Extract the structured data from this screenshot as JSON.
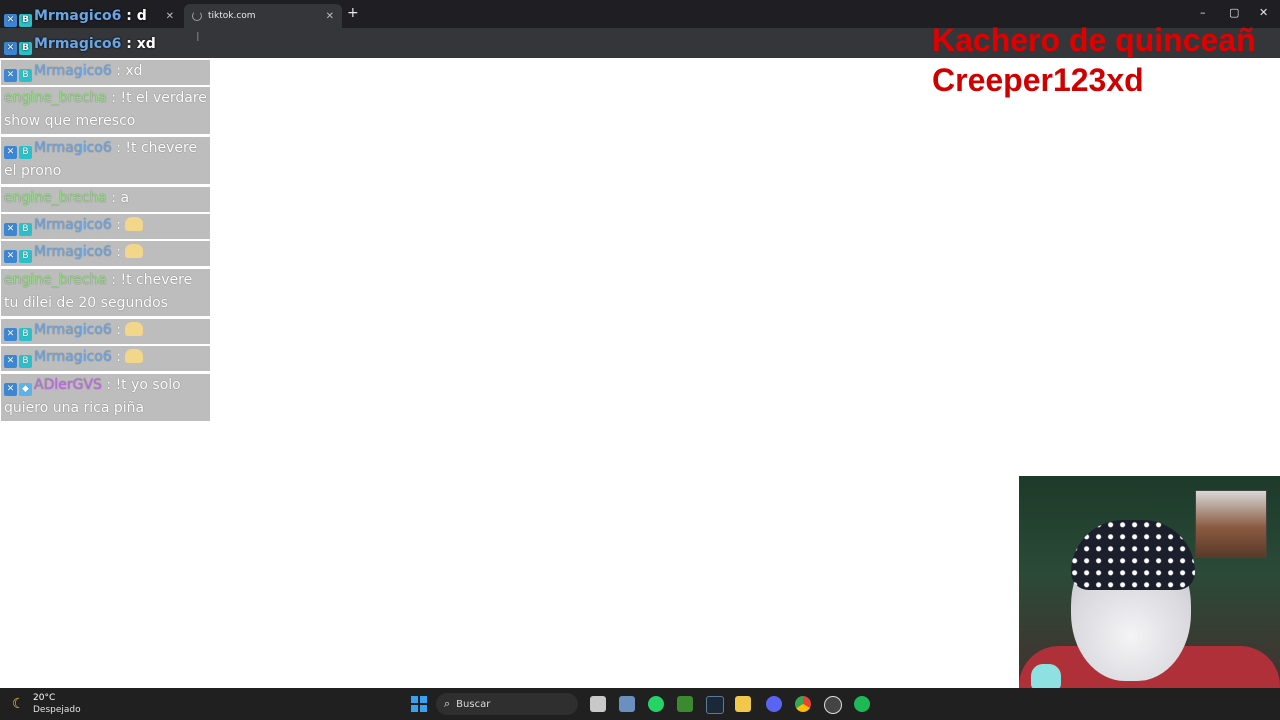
{
  "browser": {
    "tabs": [
      {
        "label": ""
      },
      {
        "label": "tiktok.com"
      }
    ],
    "new_tab_symbol": "+",
    "window_controls": {
      "minimize": "–",
      "maximize": "▢",
      "close": "✕"
    }
  },
  "chat": {
    "messages": [
      {
        "user": "Mrmagico6",
        "text": "d",
        "color": "blue"
      },
      {
        "user": "Mrmagico6",
        "text": "xd",
        "color": "blue"
      },
      {
        "user": "Mrmagico6",
        "text": "xd",
        "color": "blue"
      },
      {
        "user": "engine_brecha",
        "text": "!t el verdare show que meresco",
        "color": "green"
      },
      {
        "user": "Mrmagico6",
        "text": "!t chevere el prono",
        "color": "blue"
      },
      {
        "user": "engine_brecha",
        "text": "a",
        "color": "green"
      },
      {
        "user": "Mrmagico6",
        "text": "",
        "color": "blue"
      },
      {
        "user": "Mrmagico6",
        "text": "",
        "color": "blue"
      },
      {
        "user": "engine_brecha",
        "text": "!t chevere tu dilei de 20 segundos",
        "color": "green"
      },
      {
        "user": "Mrmagico6",
        "text": "",
        "color": "blue"
      },
      {
        "user": "Mrmagico6",
        "text": "",
        "color": "blue"
      },
      {
        "user": "ADlerGVS",
        "text": "!t yo solo quiero una rica piña",
        "color": "purple"
      }
    ]
  },
  "overlay": {
    "line1": "Kachero de quinceañ",
    "line2": "Creeper123xd",
    "color": "#e00000"
  },
  "taskbar": {
    "weather_temp": "20°C",
    "weather_desc": "Despejado",
    "search_placeholder": "Buscar"
  }
}
